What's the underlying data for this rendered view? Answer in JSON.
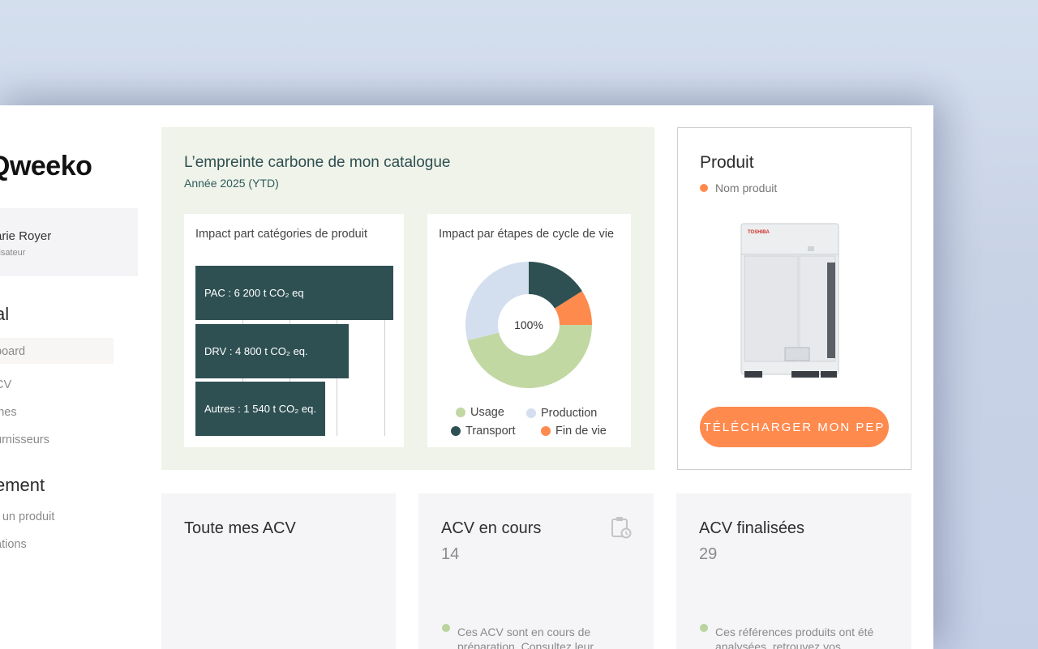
{
  "brand": {
    "logo": "Qweeko"
  },
  "user": {
    "name": "arie Royer",
    "role": "lisateur"
  },
  "sidebar": {
    "section1_title": "al",
    "items": [
      {
        "label": "board"
      },
      {
        "label": "CV"
      },
      {
        "label": "ines"
      },
      {
        "label": "urnisseurs"
      }
    ],
    "section2_title": "ement",
    "items2": [
      {
        "label": "r un produit"
      },
      {
        "label": "ations"
      }
    ]
  },
  "carbon": {
    "title": "L’empreinte carbone de mon catalogue",
    "subtitle": "Année 2025 (YTD)"
  },
  "colors": {
    "dark_teal": "#2f5053",
    "orange": "#ff8a4e",
    "green": "#c2d8a3",
    "light_blue": "#d3deef",
    "panel_green": "#eff3e9"
  },
  "chart_data": [
    {
      "type": "bar",
      "orientation": "horizontal",
      "title": "Impact part catégories de produit",
      "categories": [
        "PAC",
        "DRV",
        "Autres"
      ],
      "values": [
        6200,
        4800,
        1540
      ],
      "unit": "t CO₂ eq",
      "labels": [
        "PAC : 6 200 t CO₂ eq",
        "DRV : 4 800 t CO₂ eq.",
        "Autres : 1 540 t CO₂ eq."
      ]
    },
    {
      "type": "pie",
      "donut": true,
      "title": "Impact par étapes de cycle de vie",
      "center_label": "100%",
      "slices": [
        {
          "name": "Transport",
          "value": 16,
          "color": "#2f5053"
        },
        {
          "name": "Fin de vie",
          "value": 9,
          "color": "#ff8a4e"
        },
        {
          "name": "Usage",
          "value": 46,
          "color": "#c2d8a3"
        },
        {
          "name": "Production",
          "value": 29,
          "color": "#d3deef"
        }
      ],
      "legend": [
        "Usage",
        "Production",
        "Transport",
        "Fin de vie"
      ]
    }
  ],
  "product": {
    "title": "Produit",
    "name": "Nom produit",
    "image_brand": "TOSHIBA",
    "button": "TÉLÉCHARGER MON PEP"
  },
  "cards": [
    {
      "title": "Toute mes ACV",
      "count": "",
      "note": ""
    },
    {
      "title": "ACV en cours",
      "count": "14",
      "note": "Ces ACV sont en cours de préparation. Consultez leur",
      "icon": "clipboard-clock-icon"
    },
    {
      "title": "ACV finalisées",
      "count": "29",
      "note": "Ces références produits ont été analysées, retrouvez vos"
    }
  ]
}
